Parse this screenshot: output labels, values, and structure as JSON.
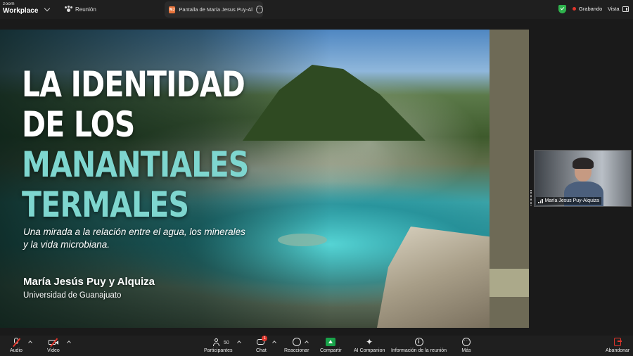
{
  "app": {
    "logo_top": "zoom",
    "logo_bottom": "Workplace",
    "meeting_label": "Reunión",
    "share_badge": "MJ",
    "share_tab_label": "Pantalla de María Jesus Puy-Alquiza",
    "share_tab_more": "···",
    "recording_label": "Grabando",
    "view_label": "Vista",
    "recording_color": "#e0352b",
    "secure_color": "#2fb34d"
  },
  "slide": {
    "title_line1": "LA IDENTIDAD",
    "title_line2": "DE LOS",
    "title_line3": "MANANTIALES",
    "title_line4": "TERMALES",
    "subtitle": "Una mirada a la relación entre el agua, los minerales y la vida microbiana.",
    "author": "María Jesús Puy y Alquiza",
    "affiliation": "Universidad de Guanajuato",
    "accent_color": "#7ed6cf"
  },
  "participant": {
    "name": "María Jesus Puy-Alquiza"
  },
  "toolbar": {
    "audio_label": "Audio",
    "video_label": "Video",
    "participants_label": "Participantes",
    "participants_count": "50",
    "chat_label": "Chat",
    "chat_badge": "1",
    "react_label": "Reaccionar",
    "share_label": "Compartir",
    "ai_label": "AI Companion",
    "info_label": "Información de la reunión",
    "more_label": "Más",
    "leave_label": "Abandonar",
    "share_color": "#19a34a"
  }
}
